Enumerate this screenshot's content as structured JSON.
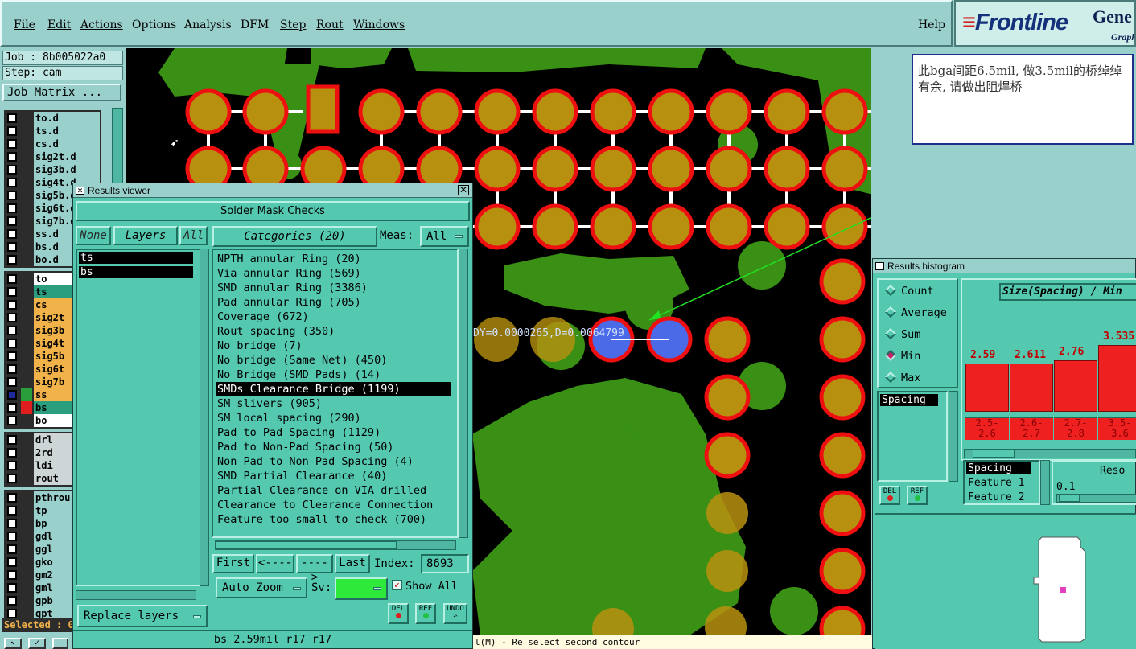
{
  "menu": {
    "file": "File",
    "edit": "Edit",
    "actions": "Actions",
    "options": "Options",
    "analysis": "Analysis",
    "dfm": "DFM",
    "step": "Step",
    "rout": "Rout",
    "windows": "Windows",
    "help": "Help"
  },
  "logo": {
    "brand": "Frontline",
    "product": "Gene",
    "sub": "Graph"
  },
  "job": {
    "job": "Job : 8b005022a0",
    "step": "Step: cam",
    "matrix_button": "Job Matrix ..."
  },
  "layers_top": [
    "to.d",
    "ts.d",
    "cs.d",
    "sig2t.d",
    "sig3b.d",
    "sig4t.d",
    "sig5b.d",
    "sig6t.d",
    "sig7b.d",
    "ss.d",
    "bs.d",
    "bo.d"
  ],
  "layers_board": [
    {
      "name": "to",
      "bg": "w",
      "color": ""
    },
    {
      "name": "ts",
      "bg": "t",
      "color": ""
    },
    {
      "name": "cs",
      "bg": "o",
      "color": ""
    },
    {
      "name": "sig2t",
      "bg": "o",
      "color": ""
    },
    {
      "name": "sig3b",
      "bg": "o",
      "color": ""
    },
    {
      "name": "sig4t",
      "bg": "o",
      "color": ""
    },
    {
      "name": "sig5b",
      "bg": "o",
      "color": ""
    },
    {
      "name": "sig6t",
      "bg": "o",
      "color": ""
    },
    {
      "name": "sig7b",
      "bg": "o",
      "color": ""
    },
    {
      "name": "ss",
      "bg": "o",
      "color": "#2a9e3a",
      "marker": "#1e2a9e"
    },
    {
      "name": "bs",
      "bg": "t",
      "color": "#e01e1e"
    },
    {
      "name": "bo",
      "bg": "w",
      "color": ""
    }
  ],
  "layers_drill": [
    "drl",
    "2rd",
    "ldi",
    "rout"
  ],
  "layers_misc": [
    "pthrou",
    "tp",
    "bp",
    "gdl",
    "ggl",
    "gko",
    "gm2",
    "gml",
    "gpb",
    "gpt"
  ],
  "selected_label": "Selected : 0",
  "annotation": "此bga间距6.5mil, 做3.5mil的桥绰绰有余, 请做出阻焊桥",
  "measure_text": "DY=0.0000265,D=0.0064799",
  "status_text": "l(M) - Re select second contour",
  "results_viewer": {
    "title": "Results viewer",
    "header": "Solder Mask Checks",
    "none_label": "None",
    "layers_label": "Layers",
    "all_label": "All",
    "categories_label": "Categories (20)",
    "meas_label": "Meas:",
    "meas_value": "All",
    "layer_list": [
      "ts",
      "bs"
    ],
    "categories": [
      "NPTH annular Ring (20)",
      "Via annular Ring (569)",
      "SMD annular Ring (3386)",
      "Pad annular Ring (705)",
      "Coverage (672)",
      "Rout spacing (350)",
      "No bridge (7)",
      "No bridge (Same Net) (450)",
      "No Bridge (SMD Pads) (14)",
      "SMDs Clearance Bridge (1199)",
      "SM slivers (905)",
      "SM local spacing (290)",
      "Pad to Pad Spacing (1129)",
      "Pad to Non-Pad Spacing (50)",
      "Non-Pad to Non-Pad Spacing (4)",
      "SMD Partial Clearance (40)",
      "Partial Clearance on VIA drilled",
      "Clearance to Clearance Connection",
      "Feature too small to check (700)"
    ],
    "selected_category": "SMDs Clearance Bridge (1199)",
    "first": "First",
    "prev": "<----",
    "next": "---->",
    "last": "Last",
    "index_label": "Index:",
    "index_value": "8693",
    "auto_zoom": "Auto Zoom",
    "sv_label": "Sv:",
    "show_all": "Show All",
    "replace_layers": "Replace layers",
    "del": "DEL",
    "ref": "REF",
    "undo": "UNDO",
    "footer": "bs 2.59mil  r17  r17"
  },
  "histogram": {
    "title": "Results histogram",
    "options": [
      "Count",
      "Average",
      "Sum",
      "Min",
      "Max"
    ],
    "selected": "Min",
    "list_item": "Spacing",
    "header": "Size(Spacing) / Min",
    "bars": [
      {
        "value": "2.59",
        "range": "2.5-\n2.6",
        "level": 0.52
      },
      {
        "value": "2.611",
        "range": "2.6-\n2.7",
        "level": 0.52
      },
      {
        "value": "2.76",
        "range": "2.7-\n2.8",
        "level": 0.56
      },
      {
        "value": "3.535",
        "range": "3.5-\n3.6",
        "level": 0.72
      }
    ],
    "fields": [
      "Spacing",
      "Feature 1",
      "Feature 2"
    ],
    "res_label": "Reso",
    "res_value": "0.1",
    "del": "DEL",
    "ref": "REF"
  },
  "colors": {
    "solder": "#b8900f",
    "mask": "#ee1010",
    "copper": "#399014",
    "selected_pad": "#4a6ae8",
    "teal": "#55c8b0"
  }
}
